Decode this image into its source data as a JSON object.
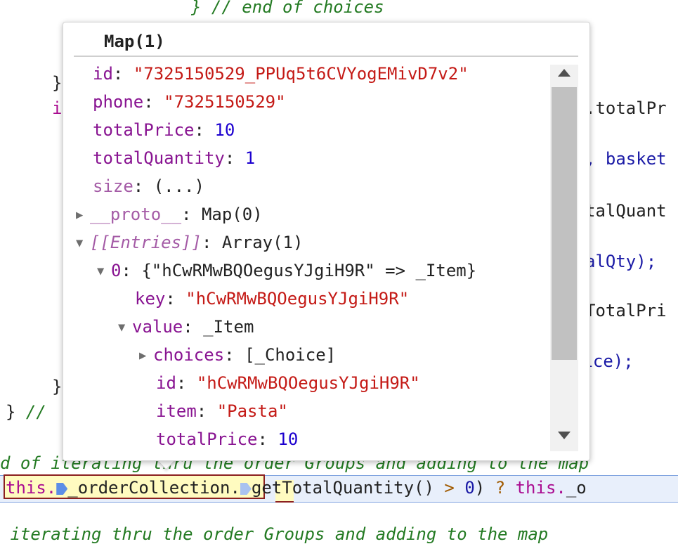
{
  "editor": {
    "line_end_of_choices": "} // end of choices",
    "line_brace_1": "}",
    "line_if": "i",
    "line_brace_2": "}",
    "line_brace_comment": "} //",
    "right_fragments": [
      ".totalPr",
      ", basket",
      "talQuant",
      "alQty);",
      "TotalPri",
      "rice);"
    ],
    "comment_line_1": "d of iterating thru the order Groups and adding to the map",
    "comment_line_2": " iterating thru the order Groups and adding to the map",
    "expression": {
      "this": "this.",
      "member": "_orderCollection",
      "dot": ".",
      "call": "getTotalQuantity()",
      "gt": " > ",
      "zero": "0",
      "close": ")",
      "ternary": " ? ",
      "this2": "this.",
      "tail": "_o"
    }
  },
  "popover": {
    "title": "Map(1)",
    "rows": {
      "id": {
        "key": "id",
        "value": "\"7325150529_PPUq5t6CVYogEMivD7v2\""
      },
      "phone": {
        "key": "phone",
        "value": "\"7325150529\""
      },
      "totalPrice": {
        "key": "totalPrice",
        "value": "10"
      },
      "totalQuantity": {
        "key": "totalQuantity",
        "value": "1"
      },
      "size": {
        "key": "size",
        "value": "(...)"
      },
      "proto": {
        "key": "__proto__",
        "value": "Map(0)"
      },
      "entries": {
        "key": "[[Entries]]",
        "value": "Array(1)"
      },
      "entry0": {
        "key": "0",
        "value": "{\"hCwRMwBQOegusYJgiH9R\" => _Item}"
      },
      "entry_key": {
        "key": "key",
        "value": "\"hCwRMwBQOegusYJgiH9R\""
      },
      "entry_value": {
        "key": "value",
        "value": "_Item"
      },
      "choices": {
        "key": "choices",
        "value": "[_Choice]"
      },
      "item_id": {
        "key": "id",
        "value": "\"hCwRMwBQOegusYJgiH9R\""
      },
      "item_name": {
        "key": "item",
        "value": "\"Pasta\""
      },
      "item_total": {
        "key": "totalPrice",
        "value": "10"
      }
    },
    "separator": ": ",
    "icons": {
      "collapsed": "▶",
      "expanded": "▼"
    }
  }
}
